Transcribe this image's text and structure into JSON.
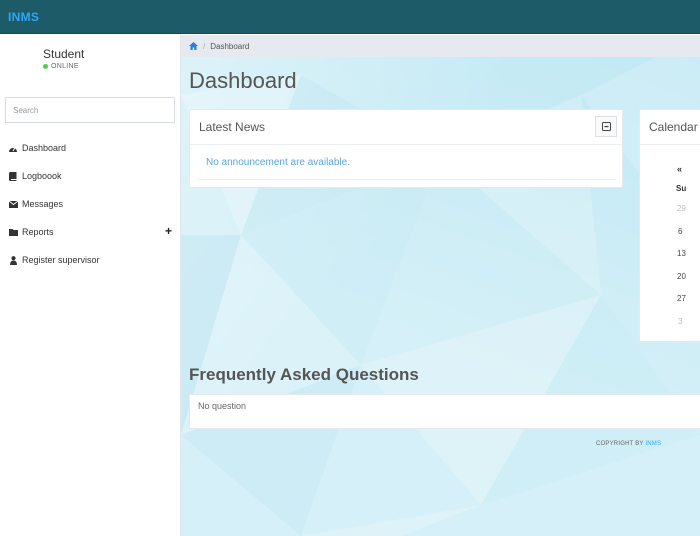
{
  "app": {
    "brand": "INMS"
  },
  "user": {
    "name": "Student",
    "status": "ONLINE"
  },
  "sidebar": {
    "search_placeholder": "Search",
    "items": [
      {
        "label": "Dashboard",
        "icon": "dashboard-icon"
      },
      {
        "label": "Logboook",
        "icon": "book-icon"
      },
      {
        "label": "Messages",
        "icon": "envelope-icon"
      },
      {
        "label": "Reports",
        "icon": "folder-icon",
        "expand": "+"
      },
      {
        "label": "Register supervisor",
        "icon": "user-icon"
      }
    ]
  },
  "breadcrumb": {
    "current": "Dashboard"
  },
  "page": {
    "title": "Dashboard"
  },
  "news": {
    "title": "Latest News",
    "empty_text": "No announcement are available."
  },
  "calendar": {
    "title": "Calendar",
    "prev": "«",
    "day_header": "Su",
    "days": [
      "29",
      "6",
      "13",
      "20",
      "27",
      "3"
    ]
  },
  "faq": {
    "title": "Frequently Asked Questions",
    "empty_text": "No question"
  },
  "footer": {
    "prefix": "COPYRIGHT BY",
    "brand": "INMS"
  },
  "colors": {
    "topbar": "#1e5b68",
    "brand": "#2fa7f5",
    "online": "#4cd14c",
    "link": "#5aa7d8"
  }
}
